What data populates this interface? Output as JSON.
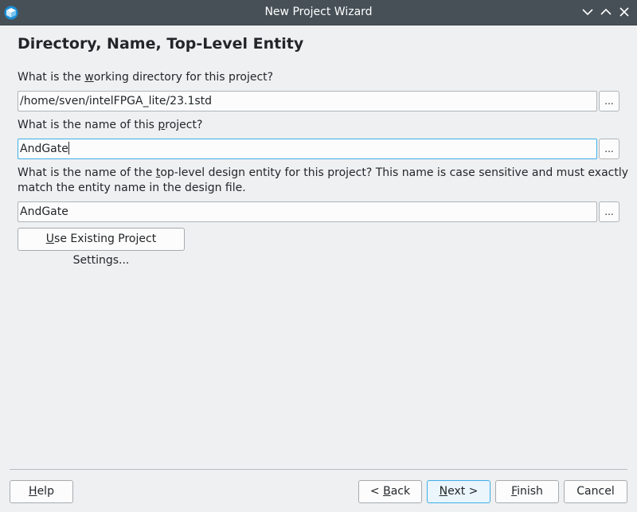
{
  "window": {
    "title": "New Project Wizard"
  },
  "page": {
    "heading": "Directory, Name, Top-Level Entity"
  },
  "fields": {
    "directory": {
      "label_pre": "What is the ",
      "label_ul": "w",
      "label_post": "orking directory for this project?",
      "value": "/home/sven/intelFPGA_lite/23.1std"
    },
    "name": {
      "label_pre": "What is the name of this ",
      "label_ul": "p",
      "label_post": "roject?",
      "value": "AndGate"
    },
    "entity": {
      "label_line1_pre": "What is the name of the ",
      "label_line1_ul": "t",
      "label_line1_post": "op-level design entity for this project? This name is case sensitive and must exactly",
      "label_line2": "match the entity name in the design file.",
      "value": "AndGate"
    },
    "browse_label": "..."
  },
  "buttons": {
    "use_existing": {
      "ul": "U",
      "rest": "se Existing Project Settings..."
    },
    "help": {
      "ul": "H",
      "rest": "elp"
    },
    "back": {
      "pre": "< ",
      "ul": "B",
      "rest": "ack"
    },
    "next": {
      "ul": "N",
      "rest": "ext >"
    },
    "finish": {
      "ul": "F",
      "rest": "inish"
    },
    "cancel": {
      "label": "Cancel"
    }
  },
  "colors": {
    "titlebar": "#475057",
    "window_bg": "#eff0f1",
    "focus_accent": "#3daee9"
  },
  "icons": {
    "app": "quartus-app-icon",
    "minimize": "chevron-down-icon",
    "maximize": "chevron-up-icon",
    "close": "close-icon"
  }
}
